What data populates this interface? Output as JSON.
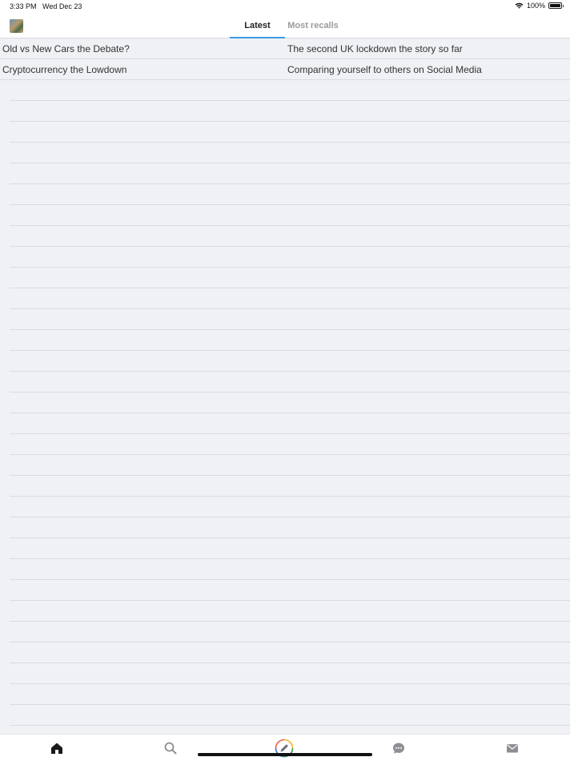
{
  "status_bar": {
    "time": "3:33 PM",
    "date": "Wed Dec 23",
    "battery": "100%"
  },
  "header": {
    "tabs": [
      {
        "label": "Latest",
        "active": true
      },
      {
        "label": "Most recalls",
        "active": false
      }
    ],
    "accent_color": "#3d9be9"
  },
  "posts": [
    {
      "left": "Old vs New Cars the Debate?",
      "right": "The second UK lockdown the story so far"
    },
    {
      "left": "Cryptocurrency the Lowdown",
      "right": "Comparing yourself to others on Social Media"
    }
  ],
  "tabbar": {
    "items": [
      "home-icon",
      "search-icon",
      "compose-icon",
      "chat-icon",
      "mail-icon"
    ]
  }
}
